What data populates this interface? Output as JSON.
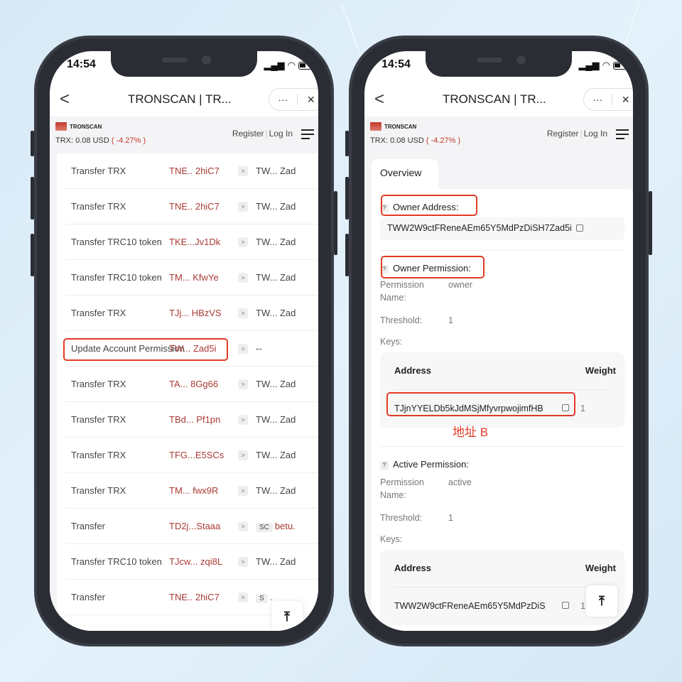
{
  "left_phone": {
    "status_time": "14:54",
    "nav": {
      "back": "<",
      "title": "TRONSCAN | TR...",
      "more": "···",
      "close": "✕"
    },
    "header": {
      "brand": "TRONSCAN",
      "price_label": "TRX: 0.08 USD",
      "change": "( -4.27% )",
      "register": "Register",
      "separator": "|",
      "login": "Log In"
    },
    "rows": [
      {
        "type": "Transfer TRX",
        "from": "TNE.. 2hiC7",
        "to": "TW... Zad"
      },
      {
        "type": "Transfer TRX",
        "from": "TNE.. 2hiC7",
        "to": "TW... Zad"
      },
      {
        "type": "Transfer TRC10 token",
        "from": "TKE...Jv1Dk",
        "to": "TW... Zad"
      },
      {
        "type": "Transfer TRC10 token",
        "from": "TM... KfwYe",
        "to": "TW... Zad"
      },
      {
        "type": "Transfer TRX",
        "from": "TJj... HBzVS",
        "to": "TW... Zad"
      },
      {
        "type": "Update Account Permission",
        "from": "TW... Zad5i",
        "to": "--"
      },
      {
        "type": "Transfer TRX",
        "from": "TA... 8Gg66",
        "to": "TW... Zad"
      },
      {
        "type": "Transfer TRX",
        "from": "TBd... Pf1pn",
        "to": "TW... Zad"
      },
      {
        "type": "Transfer TRX",
        "from": "TFG...E5SCs",
        "to": "TW... Zad"
      },
      {
        "type": "Transfer TRX",
        "from": "TM... fwx9R",
        "to": "TW... Zad"
      },
      {
        "type": "Transfer",
        "from": "TD2j...Staaa",
        "to_badge": "SC",
        "to": "betu."
      },
      {
        "type": "Transfer TRC10 token",
        "from": "TJcw... zqi8L",
        "to": "TW... Zad"
      },
      {
        "type": "Transfer",
        "from": "TNE.. 2hiC7",
        "to_badge": "S",
        "to": "."
      }
    ],
    "arrow": ">",
    "to_top": "⤒"
  },
  "right_phone": {
    "status_time": "14:54",
    "nav": {
      "back": "<",
      "title": "TRONSCAN | TR...",
      "more": "···",
      "close": "✕"
    },
    "header": {
      "brand": "TRONSCAN",
      "price_label": "TRX: 0.08 USD",
      "change": "( -4.27% )",
      "register": "Register",
      "separator": "|",
      "login": "Log In"
    },
    "tab": "Overview",
    "help": "?",
    "owner_address_label": "Owner Address:",
    "owner_address": "TWW2W9ctFReneAEm65Y5MdPzDiSH7Zad5i",
    "owner_permission": {
      "label": "Owner Permission:",
      "name_key": "Permission Name:",
      "name_val": "owner",
      "threshold_key": "Threshold:",
      "threshold_val": "1",
      "keys_label": "Keys:",
      "col_address": "Address",
      "col_weight": "Weight",
      "key_address": "TJjnYYELDb5kJdMSjMfyvrpwojimfHB",
      "key_weight": "1"
    },
    "annotation": "地址 B",
    "active_permission": {
      "label": "Active Permission:",
      "name_key": "Permission Name:",
      "name_val": "active",
      "threshold_key": "Threshold:",
      "threshold_val": "1",
      "keys_label": "Keys:",
      "col_address": "Address",
      "col_weight": "Weight",
      "key_address": "TWW2W9ctFReneAEm65Y5MdPzDiS",
      "key_weight": "1"
    },
    "to_top": "⤒"
  },
  "colors": {
    "highlight": "#e23b25",
    "link_red": "#a93a34"
  }
}
